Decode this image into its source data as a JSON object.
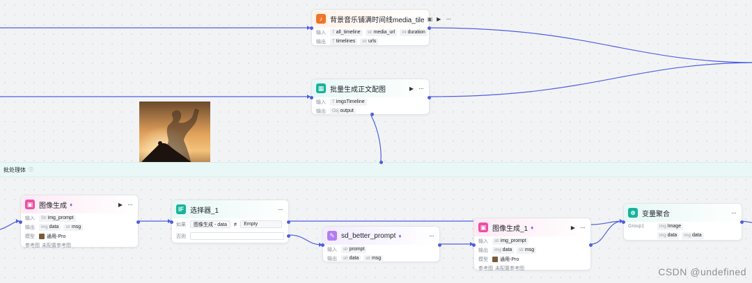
{
  "colors": {
    "edge": "#4e5fe0",
    "band": "#e9f8f6"
  },
  "labels": {
    "input": "输入",
    "output": "输出",
    "model": "模型",
    "ref": "参考图",
    "cond": "如果",
    "else": "否则",
    "group": "Group1"
  },
  "nodes": {
    "bgm": {
      "title": "背景音乐铺满时间线media_tile",
      "icon": "audio-icon",
      "inputs": [
        {
          "type": "T",
          "name": "all_timeline"
        },
        {
          "type": "str",
          "name": "media_url"
        },
        {
          "type": "int",
          "name": "duration"
        }
      ],
      "outputs": [
        {
          "type": "T",
          "name": "timelines"
        },
        {
          "type": "str",
          "name": "urls"
        }
      ]
    },
    "batch": {
      "title": "批量生成正文配图",
      "icon": "image-icon",
      "inputs": [
        {
          "type": "T",
          "name": "imgsTimeline"
        }
      ],
      "outputs": [
        {
          "type": "Obj",
          "name": "output"
        }
      ]
    },
    "img1": {
      "title": "图像生成",
      "inputs": [
        {
          "type": "Str",
          "name": "img_prompt"
        }
      ],
      "outputs": [
        {
          "type": "img",
          "name": "data"
        },
        {
          "type": "str",
          "name": "msg"
        }
      ],
      "model": "通用-Pro",
      "ref": "未配置参考图"
    },
    "selector": {
      "title": "选择器_1",
      "icon_text": "IF",
      "cond_left": "图像生成 - data",
      "op": "≠",
      "cond_right": "Empty"
    },
    "sdp": {
      "title": "sd_better_prompt",
      "inputs": [
        {
          "type": "str",
          "name": "prompt"
        }
      ],
      "outputs": [
        {
          "type": "str",
          "name": "data"
        },
        {
          "type": "str",
          "name": "msg"
        }
      ]
    },
    "img2": {
      "title": "图像生成_1",
      "inputs": [
        {
          "type": "str",
          "name": "img_prompt"
        }
      ],
      "outputs": [
        {
          "type": "img",
          "name": "data"
        },
        {
          "type": "str",
          "name": "msg"
        }
      ],
      "model": "通用-Pro",
      "ref": "未配置参考图"
    },
    "agg": {
      "title": "变量聚合",
      "group_items": [
        {
          "type": "img",
          "name": "Image"
        },
        {
          "type": "img",
          "name": "data"
        },
        {
          "type": "img",
          "name": "data"
        }
      ]
    }
  },
  "band": {
    "title": "批处理体"
  },
  "watermark": "CSDN @undefined"
}
